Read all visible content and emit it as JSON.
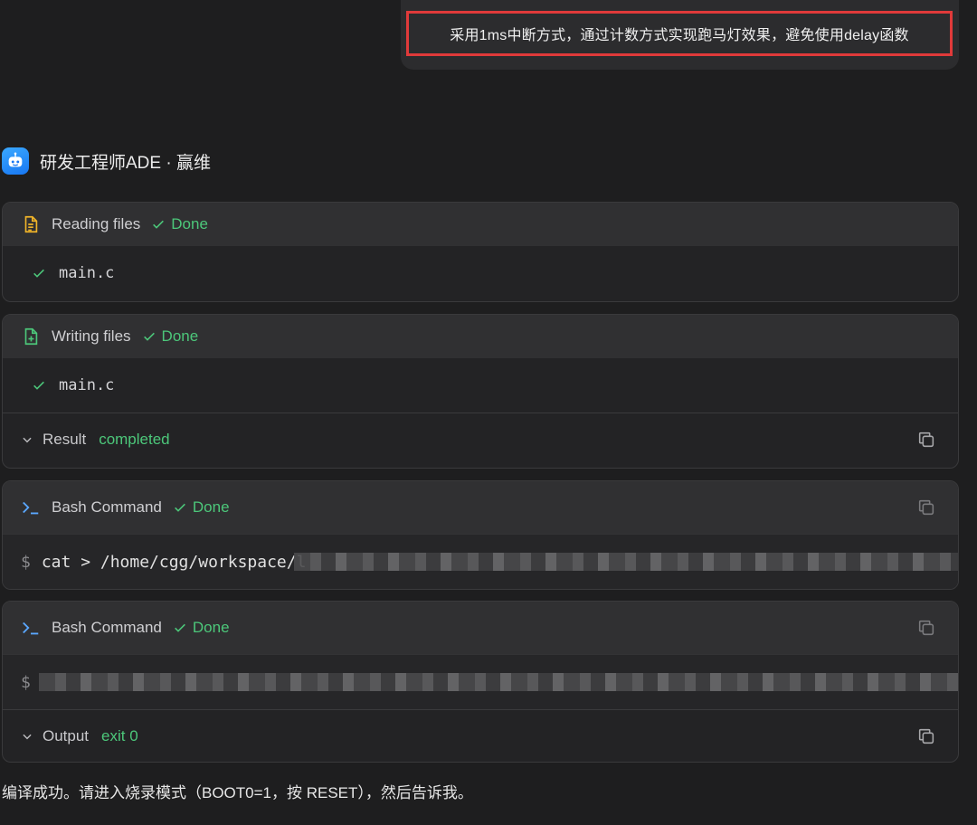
{
  "user_message": "采用1ms中断方式，通过计数方式实现跑马灯效果，避免使用delay函数",
  "agent": {
    "name": "研发工程师ADE · 赢维"
  },
  "cards": {
    "reading": {
      "title": "Reading files",
      "status": "Done",
      "file": "main.c"
    },
    "writing": {
      "title": "Writing files",
      "status": "Done",
      "file": "main.c",
      "result_label": "Result",
      "result_status": "completed"
    },
    "bash1": {
      "title": "Bash Command",
      "status": "Done",
      "prompt": "$",
      "command": "cat > /home/cgg/workspace/l"
    },
    "bash2": {
      "title": "Bash Command",
      "status": "Done",
      "prompt": "$",
      "output_label": "Output",
      "output_status": "exit 0"
    }
  },
  "footer_message": "编译成功。请进入烧录模式（BOOT0=1，按 RESET），然后告诉我。",
  "colors": {
    "accent_green": "#4cc77a",
    "highlight_red": "#e03a3a",
    "background": "#1e1e1f"
  },
  "icons": [
    "bot-icon",
    "file-text-icon",
    "file-plus-icon",
    "terminal-icon",
    "check-icon",
    "chevron-down-icon",
    "copy-icon"
  ]
}
